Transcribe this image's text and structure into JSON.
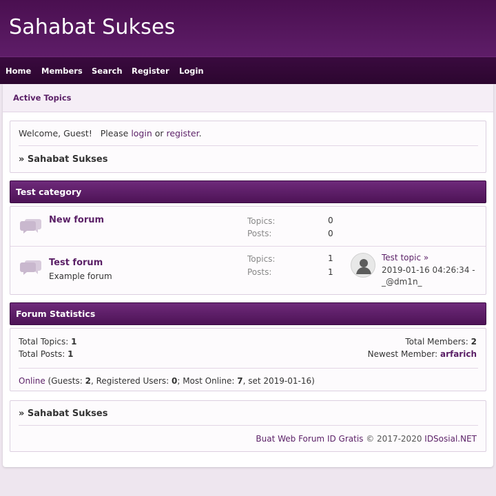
{
  "site": {
    "title": "Sahabat Sukses"
  },
  "nav": {
    "items": [
      "Home",
      "Members",
      "Search",
      "Register",
      "Login"
    ]
  },
  "tabs": {
    "active": "Active Topics"
  },
  "welcome": {
    "prefix": "Welcome, Guest!   Please ",
    "login": "login",
    "or": " or ",
    "register": "register",
    "suffix": ".",
    "breadcrumb": "» Sahabat Sukses"
  },
  "category": {
    "title": "Test category",
    "forums": [
      {
        "name": "New forum",
        "description": "",
        "topics_label": "Topics:",
        "topics": "0",
        "posts_label": "Posts:",
        "posts": "0"
      },
      {
        "name": "Test forum",
        "description": "Example forum",
        "topics_label": "Topics:",
        "topics": "1",
        "posts_label": "Posts:",
        "posts": "1",
        "last_topic": "Test topic »",
        "last_date": "2019-01-16 04:26:34 -",
        "last_user": "_@dm1n_"
      }
    ]
  },
  "statistics": {
    "title": "Forum Statistics",
    "total_topics_label": "Total Topics: ",
    "total_topics": "1",
    "total_posts_label": "Total Posts: ",
    "total_posts": "1",
    "total_members_label": "Total Members: ",
    "total_members": "2",
    "newest_member_label": "Newest Member: ",
    "newest_member": "arfarich",
    "online_link": "Online",
    "online_guests_label": " (Guests: ",
    "online_guests": "2",
    "online_registered_label": ", Registered Users: ",
    "online_registered": "0",
    "most_online_label": "; Most Online: ",
    "most_online": "7",
    "most_online_date": ", set 2019-01-16)"
  },
  "footer": {
    "breadcrumb": "» Sahabat Sukses",
    "credit_link": "Buat Web Forum ID Gratis",
    "credit_text": " © 2017-2020 ",
    "credit_brand": "IDSosial.NET"
  },
  "colors": {
    "header": "#4a0f50",
    "nav": "#2c062f",
    "accent": "#5a1f66",
    "background": "#eee6ef"
  }
}
